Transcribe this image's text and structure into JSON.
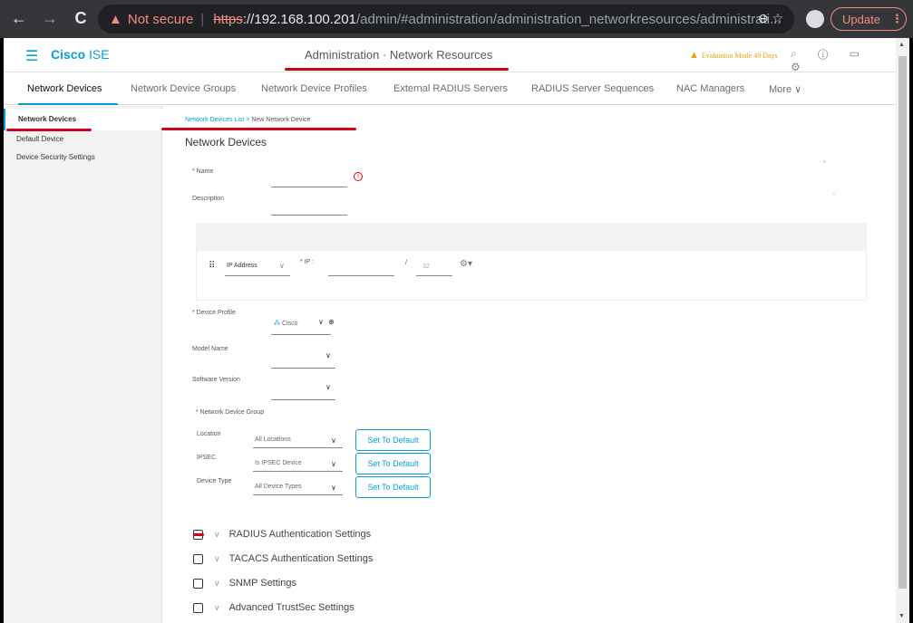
{
  "browser": {
    "back": "←",
    "forward": "→",
    "reload": "C",
    "warning_label": "Not secure",
    "url_scheme": "https",
    "url_host": "://192.168.100.201",
    "url_path": "/admin/#administration/administration_networkresources/administrati...",
    "update_label": "Update"
  },
  "header": {
    "brand_prefix": "Cisco",
    "brand_suffix": "ISE",
    "title": "Administration · Network Resources",
    "evaluation": "Evaluation Mode 49 Days"
  },
  "tabs": [
    {
      "label": "Network Devices"
    },
    {
      "label": "Network Device Groups"
    },
    {
      "label": "Network Device Profiles"
    },
    {
      "label": "External RADIUS Servers"
    },
    {
      "label": "RADIUS Server Sequences"
    },
    {
      "label": "NAC Managers"
    },
    {
      "label": "More ∨"
    }
  ],
  "sidebar": {
    "items": [
      {
        "label": "Network Devices"
      },
      {
        "label": "Default Device"
      },
      {
        "label": "Device Security Settings"
      }
    ]
  },
  "breadcrumb": {
    "parent": "Network Devices List",
    "separator": ">",
    "current": "New Network Device"
  },
  "form": {
    "section_title": "Network Devices",
    "name_label": "* Name",
    "description_label": "Description",
    "ip_type": "IP Address",
    "ip_label": "* IP :",
    "slash": "/",
    "mask_placeholder": "32",
    "device_profile_label": "* Device Profile",
    "device_profile_value": "Cisco",
    "model_name_label": "Model Name",
    "software_version_label": "Software Version",
    "ndg_label": "* Network Device Group",
    "location_label": "Location",
    "location_value": "All Locations",
    "ipsec_label": "IPSEC",
    "ipsec_value": "Is IPSEC Device",
    "device_type_label": "Device Type",
    "device_type_value": "All Device Types",
    "set_default": "Set To Default"
  },
  "settings": [
    {
      "label": "RADIUS Authentication Settings",
      "checked": true
    },
    {
      "label": "TACACS Authentication Settings",
      "checked": false
    },
    {
      "label": "SNMP Settings",
      "checked": false
    },
    {
      "label": "Advanced TrustSec Settings",
      "checked": false
    }
  ],
  "colors": {
    "accent": "#049fd9",
    "annotation": "#d0021b",
    "warning": "#e2a30b"
  }
}
